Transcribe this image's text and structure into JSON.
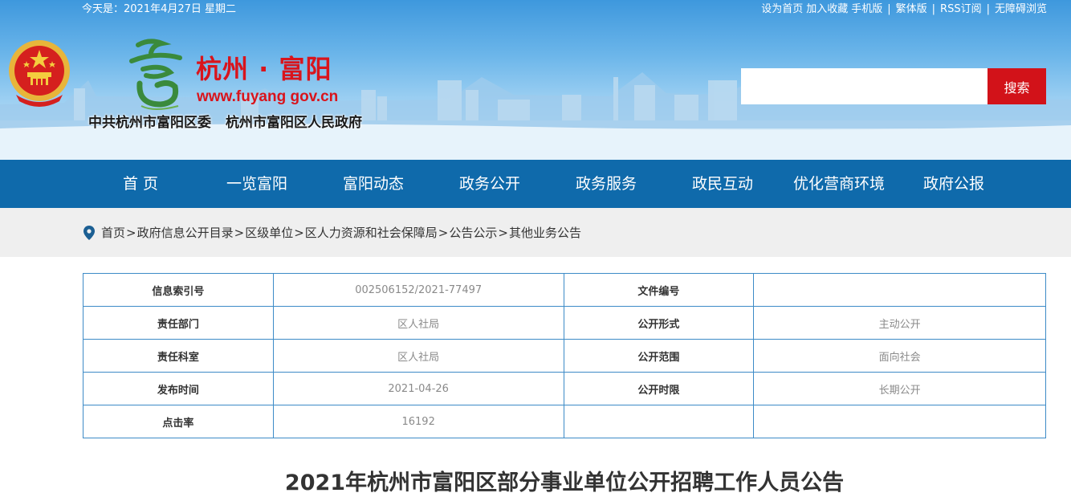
{
  "topbar": {
    "date": "今天是：2021年4月27日 星期二",
    "links": {
      "set_home": "设为首页",
      "favorite": "加入收藏",
      "mobile": "手机版",
      "traditional": "繁体版",
      "rss": "RSS订阅",
      "accessible": "无障碍浏览"
    },
    "separator": "|"
  },
  "brand": {
    "site_name": "杭州 · 富阳",
    "site_url": "www.fuyang gov.cn",
    "org_party": "中共杭州市富阳区委",
    "org_government": "杭州市富阳区人民政府",
    "accent_color": "#d9141c"
  },
  "search": {
    "placeholder": "",
    "button_label": "搜索"
  },
  "nav": {
    "items": [
      "首 页",
      "一览富阳",
      "富阳动态",
      "政务公开",
      "政务服务",
      "政民互动",
      "优化营商环境",
      "政府公报"
    ]
  },
  "breadcrumb": {
    "items": [
      "首页",
      "政府信息公开目录",
      "区级单位",
      "区人力资源和社会保障局",
      "公告公示",
      "其他业务公告"
    ],
    "separator": ">"
  },
  "info_table": {
    "rows": [
      {
        "label1": "信息索引号",
        "value1": "002506152/2021-77497",
        "label2": "文件编号",
        "value2": ""
      },
      {
        "label1": "责任部门",
        "value1": "区人社局",
        "label2": "公开形式",
        "value2": "主动公开"
      },
      {
        "label1": "责任科室",
        "value1": "区人社局",
        "label2": "公开范围",
        "value2": "面向社会"
      },
      {
        "label1": "发布时间",
        "value1": "2021-04-26",
        "label2": "公开时限",
        "value2": "长期公开"
      },
      {
        "label1": "点击率",
        "value1": "16192",
        "label2": "",
        "value2": ""
      }
    ]
  },
  "article": {
    "title": "2021年杭州市富阳区部分事业单位公开招聘工作人员公告"
  },
  "colors": {
    "nav_bg": "#0f6aab",
    "search_button": "#d21219",
    "table_border": "#3d8bc7"
  },
  "icons": {
    "location": "map-pin-icon",
    "emblem": "national-emblem-icon",
    "logo": "fuyang-logo-icon"
  }
}
